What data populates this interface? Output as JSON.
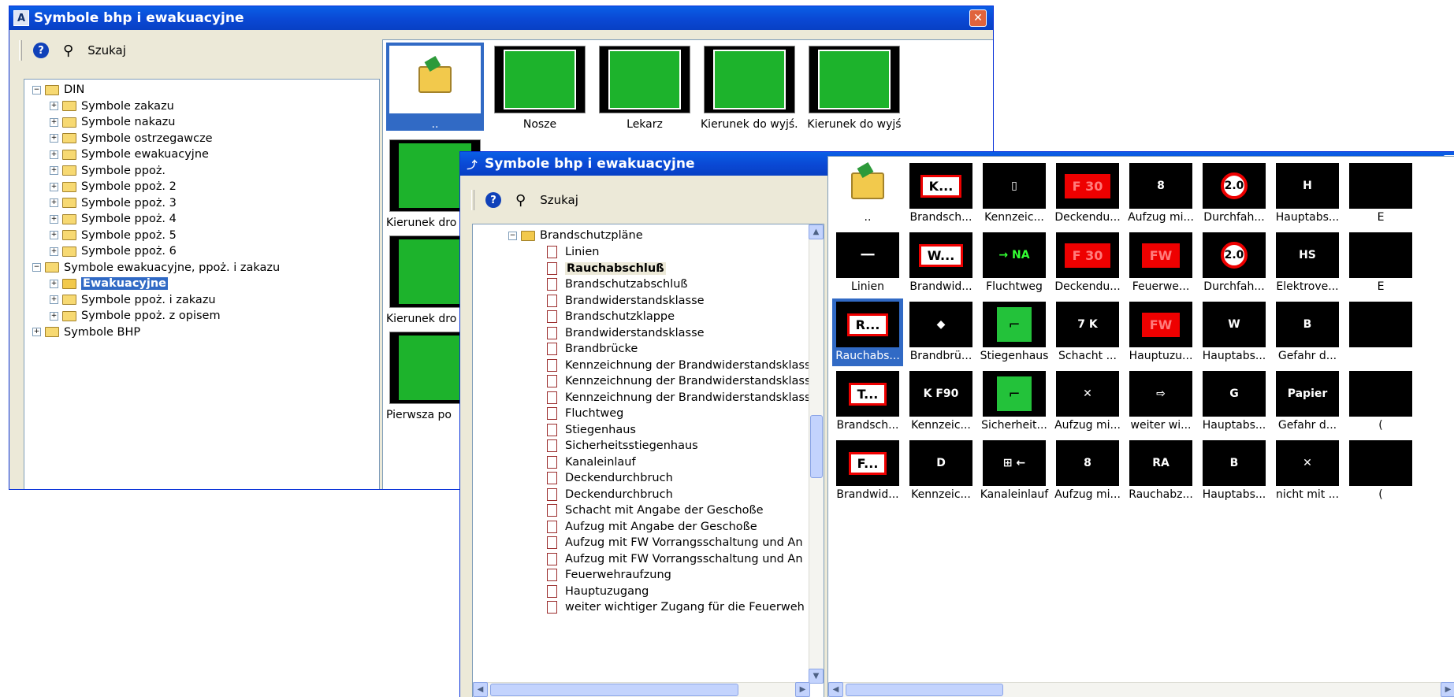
{
  "w1": {
    "title": "Symbole bhp i ewakuacyjne",
    "search": "Szukaj",
    "tree": [
      {
        "label": "DIN",
        "exp": "⊟",
        "indent": 0
      },
      {
        "label": "Symbole zakazu",
        "exp": "⊞",
        "indent": 1
      },
      {
        "label": "Symbole nakazu",
        "exp": "⊞",
        "indent": 1
      },
      {
        "label": "Symbole ostrzegawcze",
        "exp": "⊞",
        "indent": 1
      },
      {
        "label": "Symbole ewakuacyjne",
        "exp": "⊞",
        "indent": 1
      },
      {
        "label": "Symbole ppoż.",
        "exp": "⊞",
        "indent": 1
      },
      {
        "label": "Symbole ppoż. 2",
        "exp": "⊞",
        "indent": 1
      },
      {
        "label": "Symbole ppoż. 3",
        "exp": "⊞",
        "indent": 1
      },
      {
        "label": "Symbole ppoż. 4",
        "exp": "⊞",
        "indent": 1
      },
      {
        "label": "Symbole ppoż. 5",
        "exp": "⊞",
        "indent": 1
      },
      {
        "label": "Symbole ppoż. 6",
        "exp": "⊞",
        "indent": 1
      },
      {
        "label": "Symbole ewakuacyjne, ppoż. i zakazu",
        "exp": "⊟",
        "indent": 0
      },
      {
        "label": "Ewakuacyjne",
        "exp": "⊞",
        "indent": 1,
        "selected": true
      },
      {
        "label": "Symbole ppoż. i zakazu",
        "exp": "⊞",
        "indent": 1
      },
      {
        "label": "Symbole ppoż. z opisem",
        "exp": "⊞",
        "indent": 1
      },
      {
        "label": "Symbole BHP",
        "exp": "⊞",
        "indent": 0
      }
    ],
    "tiles_row1": [
      "..",
      "Nosze",
      "Lekarz",
      "Kierunek do wyjś...",
      "Kierunek do wyjś"
    ],
    "tiles_col1": [
      "Kierunek dro",
      "Kierunek dro",
      "Pierwsza po"
    ]
  },
  "w2": {
    "title": "Symbole bhp i ewakuacyjne",
    "search": "Szukaj",
    "tree_root": "Brandschutzpläne",
    "tree_items": [
      "Linien",
      "Rauchabschluß",
      "Brandschutzabschluß",
      "Brandwiderstandsklasse",
      "Brandschutzklappe",
      "Brandwiderstandsklasse",
      "Brandbrücke",
      "Kennzeichnung der Brandwiderstandsklass",
      "Kennzeichnung der Brandwiderstandsklass",
      "Kennzeichnung der Brandwiderstandsklass",
      "Fluchtweg",
      "Stiegenhaus",
      "Sicherheitsstiegenhaus",
      "Kanaleinlauf",
      "Deckendurchbruch",
      "Deckendurchbruch",
      "Schacht mit Angabe der Geschoße",
      "Aufzug mit Angabe der Geschoße",
      "Aufzug mit FW Vorrangsschaltung und An",
      "Aufzug mit FW Vorrangsschaltung und An",
      "Feuerwehraufzung",
      "Hauptuzugang",
      "weiter wichtiger Zugang für die Feuerweh"
    ],
    "grid": [
      [
        {
          "cap": "..",
          "sym": "folder"
        },
        {
          "cap": "Brandsch...",
          "sym": "K..."
        },
        {
          "cap": "Kennzeic...",
          "sym": "▯"
        },
        {
          "cap": "Deckendu...",
          "sym": "F 30"
        },
        {
          "cap": "Aufzug mi...",
          "sym": "8"
        },
        {
          "cap": "Durchfah...",
          "sym": "2.0"
        },
        {
          "cap": "Hauptabs...",
          "sym": "H"
        },
        {
          "cap": "E",
          "sym": ""
        }
      ],
      [
        {
          "cap": "Linien",
          "sym": "━━"
        },
        {
          "cap": "Brandwid...",
          "sym": "W..."
        },
        {
          "cap": "Fluchtweg",
          "sym": "→ NA"
        },
        {
          "cap": "Deckendu...",
          "sym": "F 30"
        },
        {
          "cap": "Feuerwe...",
          "sym": "FW"
        },
        {
          "cap": "Durchfah...",
          "sym": "2.0"
        },
        {
          "cap": "Elektrove...",
          "sym": "HS"
        },
        {
          "cap": "E",
          "sym": ""
        }
      ],
      [
        {
          "cap": "Rauchabs...",
          "sym": "R...",
          "selected": true
        },
        {
          "cap": "Brandbrü...",
          "sym": "◆"
        },
        {
          "cap": "Stiegenhaus",
          "sym": "⌐"
        },
        {
          "cap": "Schacht ...",
          "sym": "7 K"
        },
        {
          "cap": "Hauptuzu...",
          "sym": "FW"
        },
        {
          "cap": "Hauptabs...",
          "sym": "W"
        },
        {
          "cap": "Gefahr d...",
          "sym": "B"
        },
        {
          "cap": "",
          "sym": ""
        }
      ],
      [
        {
          "cap": "Brandsch...",
          "sym": "T..."
        },
        {
          "cap": "Kennzeic...",
          "sym": "K F90"
        },
        {
          "cap": "Sicherheit...",
          "sym": "⌐"
        },
        {
          "cap": "Aufzug mi...",
          "sym": "✕"
        },
        {
          "cap": "weiter wi...",
          "sym": "⇨"
        },
        {
          "cap": "Hauptabs...",
          "sym": "G"
        },
        {
          "cap": "Gefahr d...",
          "sym": "Papier"
        },
        {
          "cap": "(",
          "sym": ""
        }
      ],
      [
        {
          "cap": "Brandwid...",
          "sym": "F..."
        },
        {
          "cap": "Kennzeic...",
          "sym": "D"
        },
        {
          "cap": "Kanaleinlauf",
          "sym": "⊞ ←"
        },
        {
          "cap": "Aufzug mi...",
          "sym": "8"
        },
        {
          "cap": "Rauchabz...",
          "sym": "RA"
        },
        {
          "cap": "Hauptabs...",
          "sym": "B"
        },
        {
          "cap": "nicht mit ...",
          "sym": "✕"
        },
        {
          "cap": "(",
          "sym": ""
        }
      ]
    ]
  }
}
